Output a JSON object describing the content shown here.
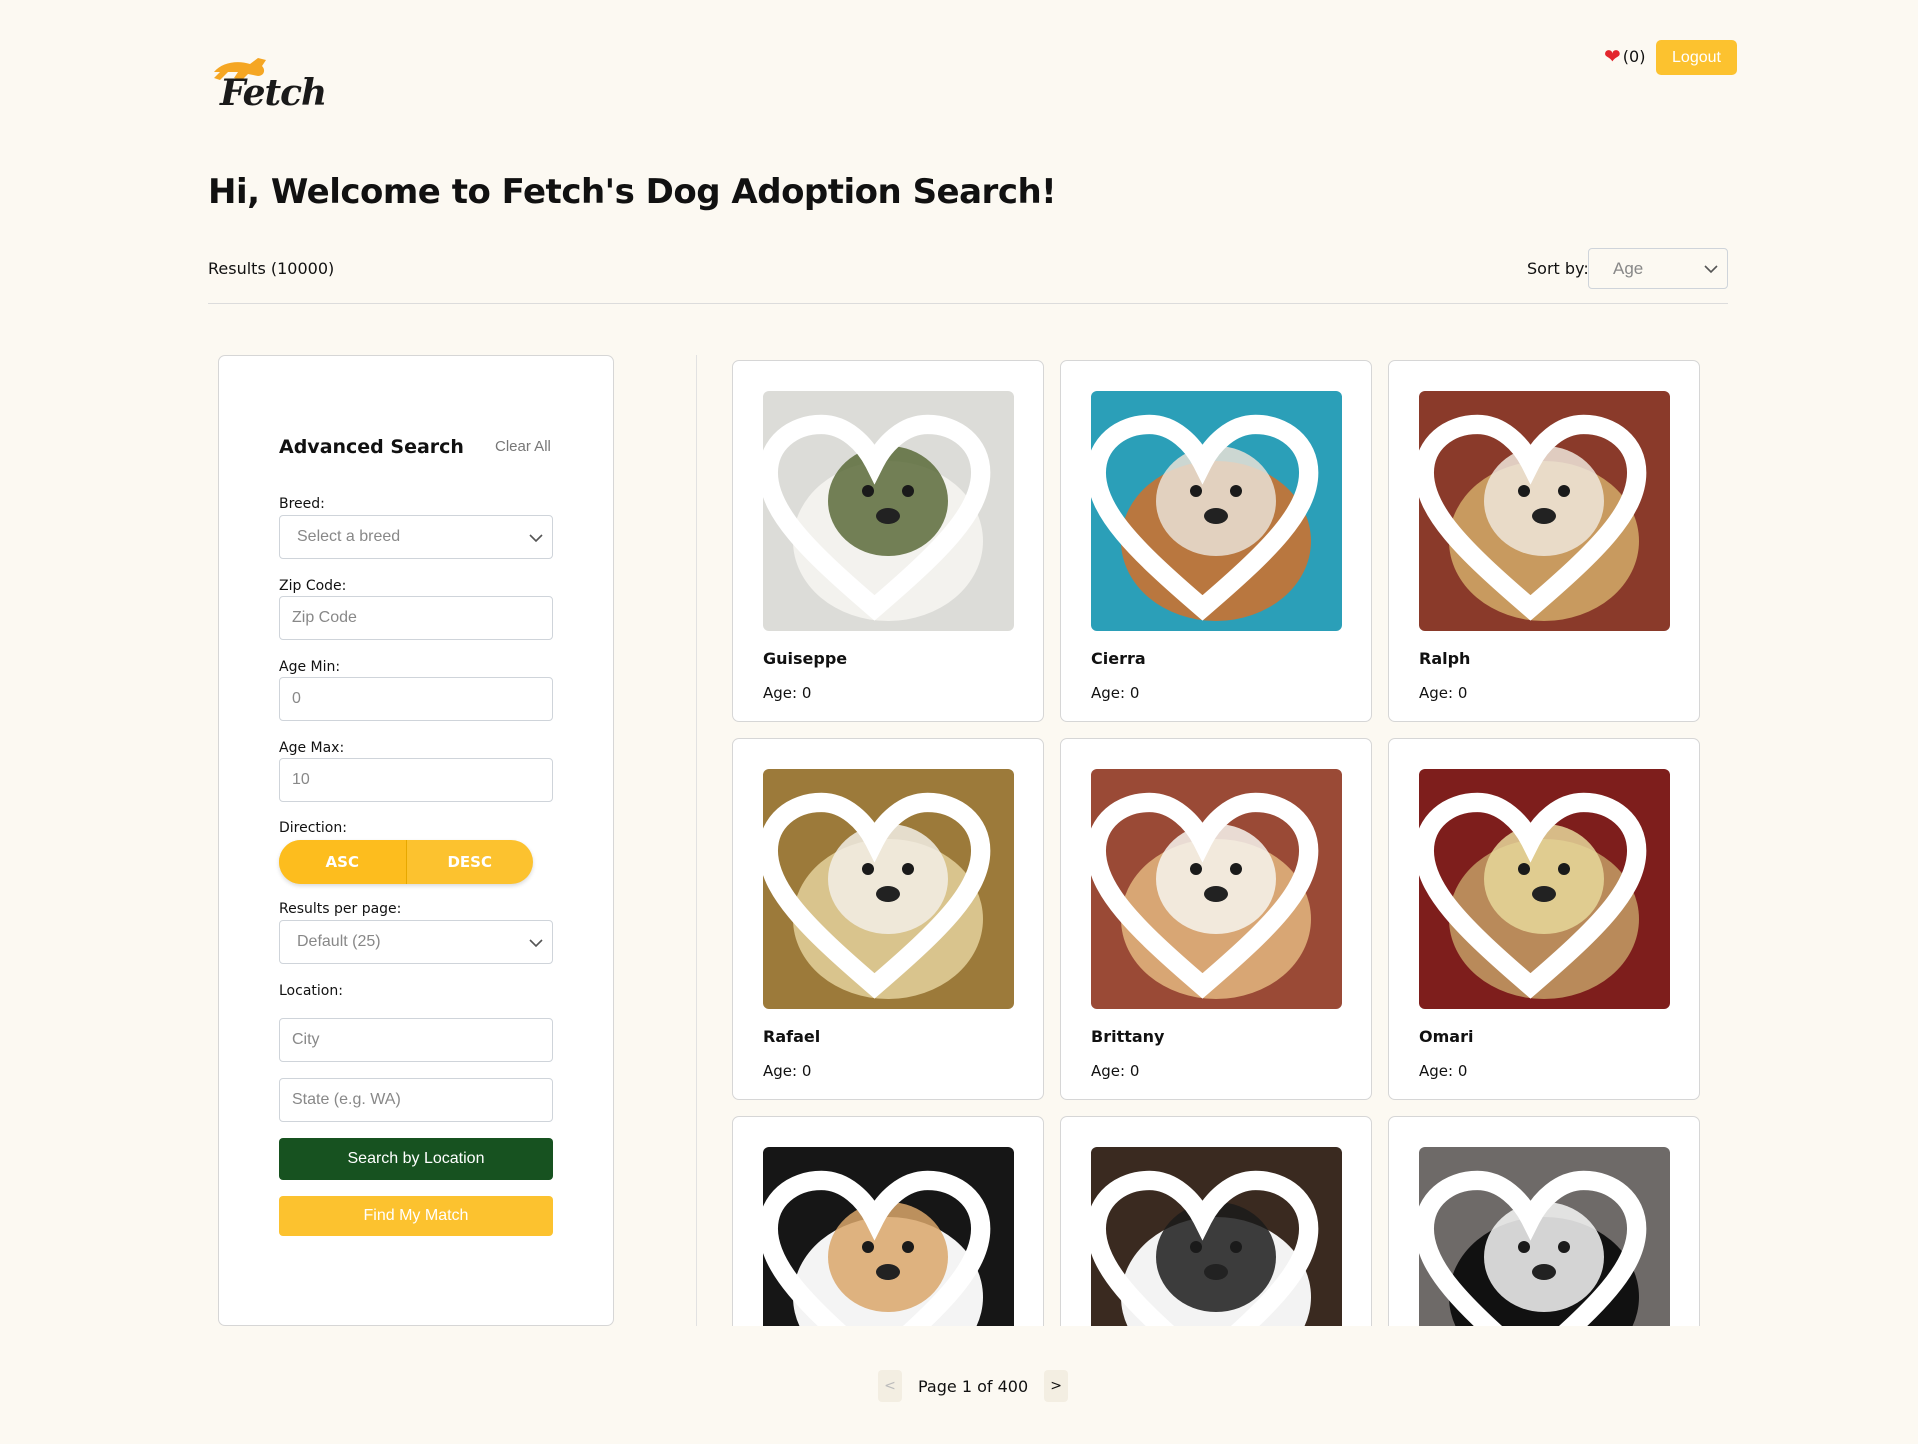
{
  "header": {
    "logo_text": "Fetch",
    "favorites_count": "(0)",
    "logout_label": "Logout"
  },
  "welcome_title": "Hi, Welcome to Fetch's Dog Adoption Search!",
  "results_label": "Results (10000)",
  "sort": {
    "label": "Sort by:",
    "value": "Age"
  },
  "search_panel": {
    "title": "Advanced Search",
    "clear_label": "Clear All",
    "breed_label": "Breed:",
    "breed_placeholder": "Select a breed",
    "zip_label": "Zip Code:",
    "zip_placeholder": "Zip Code",
    "age_min_label": "Age Min:",
    "age_min_value": "0",
    "age_max_label": "Age Max:",
    "age_max_value": "10",
    "direction_label": "Direction:",
    "asc_label": "ASC",
    "desc_label": "DESC",
    "per_page_label": "Results per page:",
    "per_page_value": "Default (25)",
    "location_label": "Location:",
    "city_placeholder": "City",
    "state_placeholder": "State (e.g. WA)",
    "search_location_label": "Search by Location",
    "find_match_label": "Find My Match"
  },
  "dogs": [
    {
      "name": "Guiseppe",
      "age": "Age: 0",
      "colors": [
        "#dcdcd8",
        "#f3f2ee",
        "#5a6b3a"
      ]
    },
    {
      "name": "Cierra",
      "age": "Age: 0",
      "colors": [
        "#2b9fb8",
        "#b9773f",
        "#e9e1d6"
      ]
    },
    {
      "name": "Ralph",
      "age": "Age: 0",
      "colors": [
        "#8a3a2a",
        "#c89a5f",
        "#efe6da"
      ]
    },
    {
      "name": "Rafael",
      "age": "Age: 0",
      "colors": [
        "#9c7a3a",
        "#d9c48d",
        "#f2eee6"
      ]
    },
    {
      "name": "Brittany",
      "age": "Age: 0",
      "colors": [
        "#9a4a36",
        "#d8a674",
        "#f7f4ef"
      ]
    },
    {
      "name": "Omari",
      "age": "Age: 0",
      "colors": [
        "#7e1e1c",
        "#b98a5a",
        "#e6d79a"
      ]
    },
    {
      "name": "",
      "age": "",
      "colors": [
        "#161616",
        "#f4f4f4",
        "#d9a66a"
      ]
    },
    {
      "name": "",
      "age": "",
      "colors": [
        "#3a2a20",
        "#f3f3f3",
        "#1b1b1b"
      ]
    },
    {
      "name": "",
      "age": "",
      "colors": [
        "#6e6a68",
        "#111111",
        "#f7f7f7"
      ]
    }
  ],
  "pagination": {
    "prev": "<",
    "text": "Page 1 of 400",
    "next": ">"
  }
}
